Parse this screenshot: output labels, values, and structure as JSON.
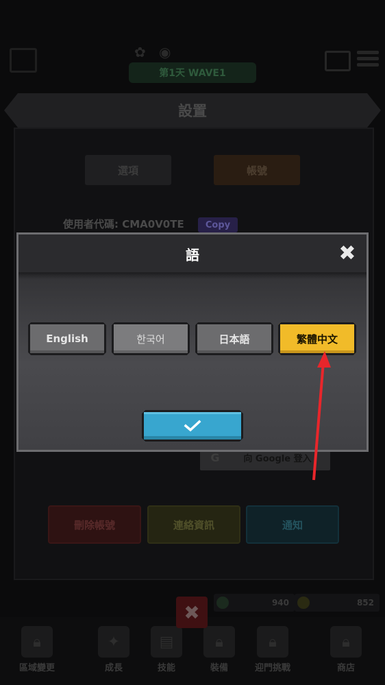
{
  "hud": {
    "wave_label": "第1天 WAVE1"
  },
  "settings": {
    "title": "設置",
    "tabs": [
      {
        "label": "選項"
      },
      {
        "label": "帳號"
      }
    ],
    "user_code_label": "使用者代碼: CMA0V0TE",
    "copy_label": "Copy",
    "google_label": "向 Google 登入",
    "actions": {
      "delete_account": "刪除帳號",
      "contact_info": "連絡資訊",
      "notice": "通知"
    }
  },
  "language_dialog": {
    "title": "語",
    "languages": [
      {
        "label": "English",
        "selected": false
      },
      {
        "label": "한국어",
        "selected": false
      },
      {
        "label": "日本語",
        "selected": false
      },
      {
        "label": "繁體中文",
        "selected": true
      }
    ],
    "close_icon": "close-x-icon",
    "confirm_icon": "checkmark-icon",
    "accent_color": "#f1bb29",
    "confirm_color": "#38a6cf"
  },
  "bottom": {
    "currency_1": "940",
    "currency_2": "852",
    "nav": [
      {
        "label": "區域變更"
      },
      {
        "label": "成長"
      },
      {
        "label": "技能"
      },
      {
        "label": "裝備"
      },
      {
        "label": "迎門挑戰"
      },
      {
        "label": "商店"
      }
    ]
  },
  "annotation": {
    "arrow_color": "#e8262b"
  }
}
